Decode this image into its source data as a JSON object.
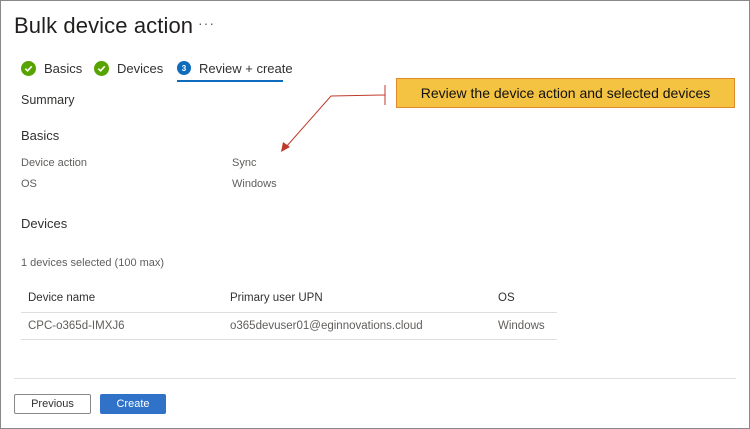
{
  "header": {
    "title": "Bulk device action",
    "more_glyph": "···"
  },
  "steps": [
    {
      "label": "Basics",
      "state": "done"
    },
    {
      "label": "Devices",
      "state": "done"
    },
    {
      "label": "Review + create",
      "state": "current",
      "number": "3"
    }
  ],
  "summary_label": "Summary",
  "basics": {
    "heading": "Basics",
    "rows": [
      {
        "key": "Device action",
        "value": "Sync"
      },
      {
        "key": "OS",
        "value": "Windows"
      }
    ]
  },
  "devices": {
    "heading": "Devices",
    "selected_text": "1 devices selected (100 max)",
    "columns": [
      "Device name",
      "Primary user UPN",
      "OS"
    ],
    "rows": [
      [
        "CPC-o365d-IMXJ6",
        "o365devuser01@eginnovations.cloud",
        "Windows"
      ]
    ]
  },
  "footer": {
    "previous_label": "Previous",
    "create_label": "Create"
  },
  "annotation": {
    "text": "Review the device action and selected devices"
  },
  "colors": {
    "accent": "#0f6cbd",
    "success": "#57a300",
    "primary_button": "#2f72c8",
    "callout_fill": "#f5c342",
    "callout_border": "#e08a2c",
    "annotation_arrow": "#c0392b"
  }
}
